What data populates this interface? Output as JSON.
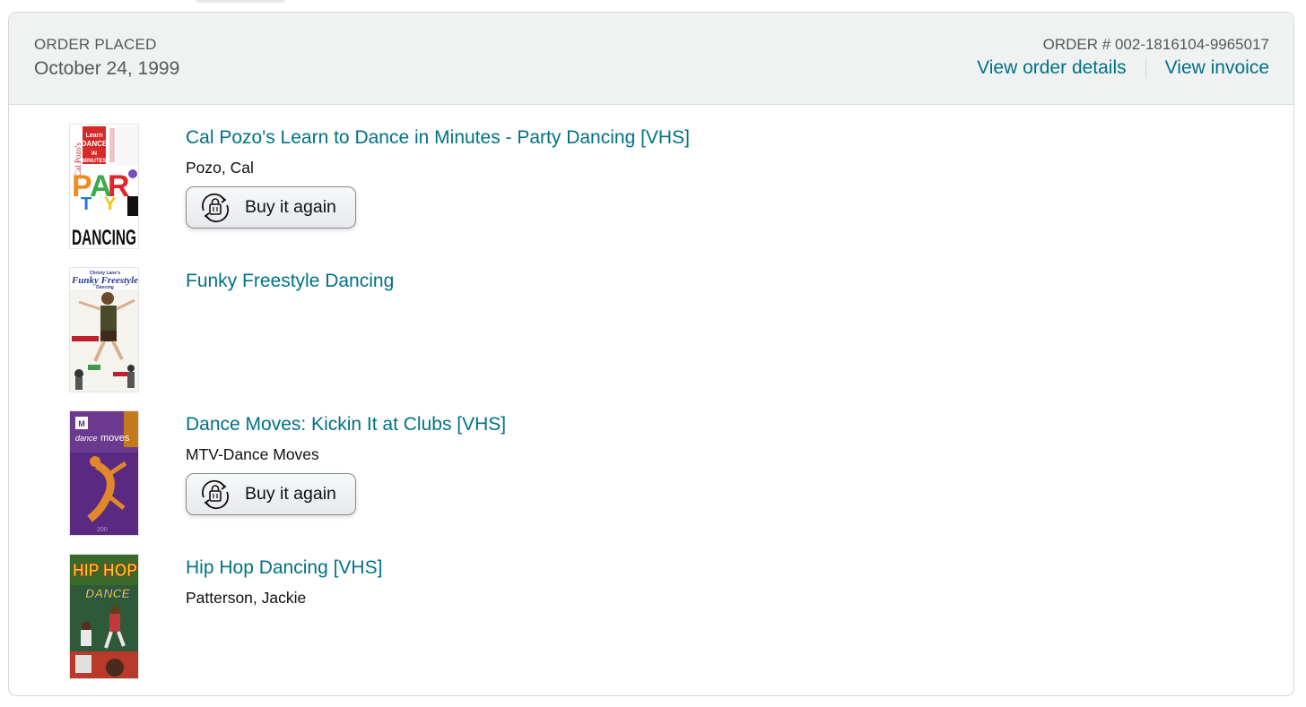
{
  "order": {
    "placed_label": "ORDER PLACED",
    "placed_date": "October 24, 1999",
    "number_text": "ORDER # 002-1816104-9965017",
    "view_details_label": "View order details",
    "view_invoice_label": "View invoice"
  },
  "items": [
    {
      "title": "Cal Pozo's Learn to Dance in Minutes - Party Dancing [VHS]",
      "author": "Pozo, Cal",
      "buy_again_label": "Buy it again",
      "cover_lettering": [
        "Cal Pozo's",
        "Learn To DANCE In MINUTES",
        "PARTY",
        "DANCING"
      ]
    },
    {
      "title": "Funky Freestyle Dancing",
      "author": "",
      "cover_lettering": [
        "Christy Lane's",
        "Funky Freestyle",
        "Dancing"
      ]
    },
    {
      "title": "Dance Moves: Kickin It at Clubs [VHS]",
      "author": "MTV-Dance Moves",
      "buy_again_label": "Buy it again",
      "cover_lettering": [
        "MTV",
        "dance moves"
      ]
    },
    {
      "title": "Hip Hop Dancing [VHS]",
      "author": "Patterson, Jackie",
      "cover_lettering": [
        "HIP HOP",
        "DANCE"
      ]
    }
  ],
  "colors": {
    "link": "#007185",
    "header_bg": "#f0f2f2",
    "border": "#d5d9d9",
    "muted_text": "#565959"
  },
  "icons": {
    "buy_again": "reorder-cycle-icon"
  }
}
